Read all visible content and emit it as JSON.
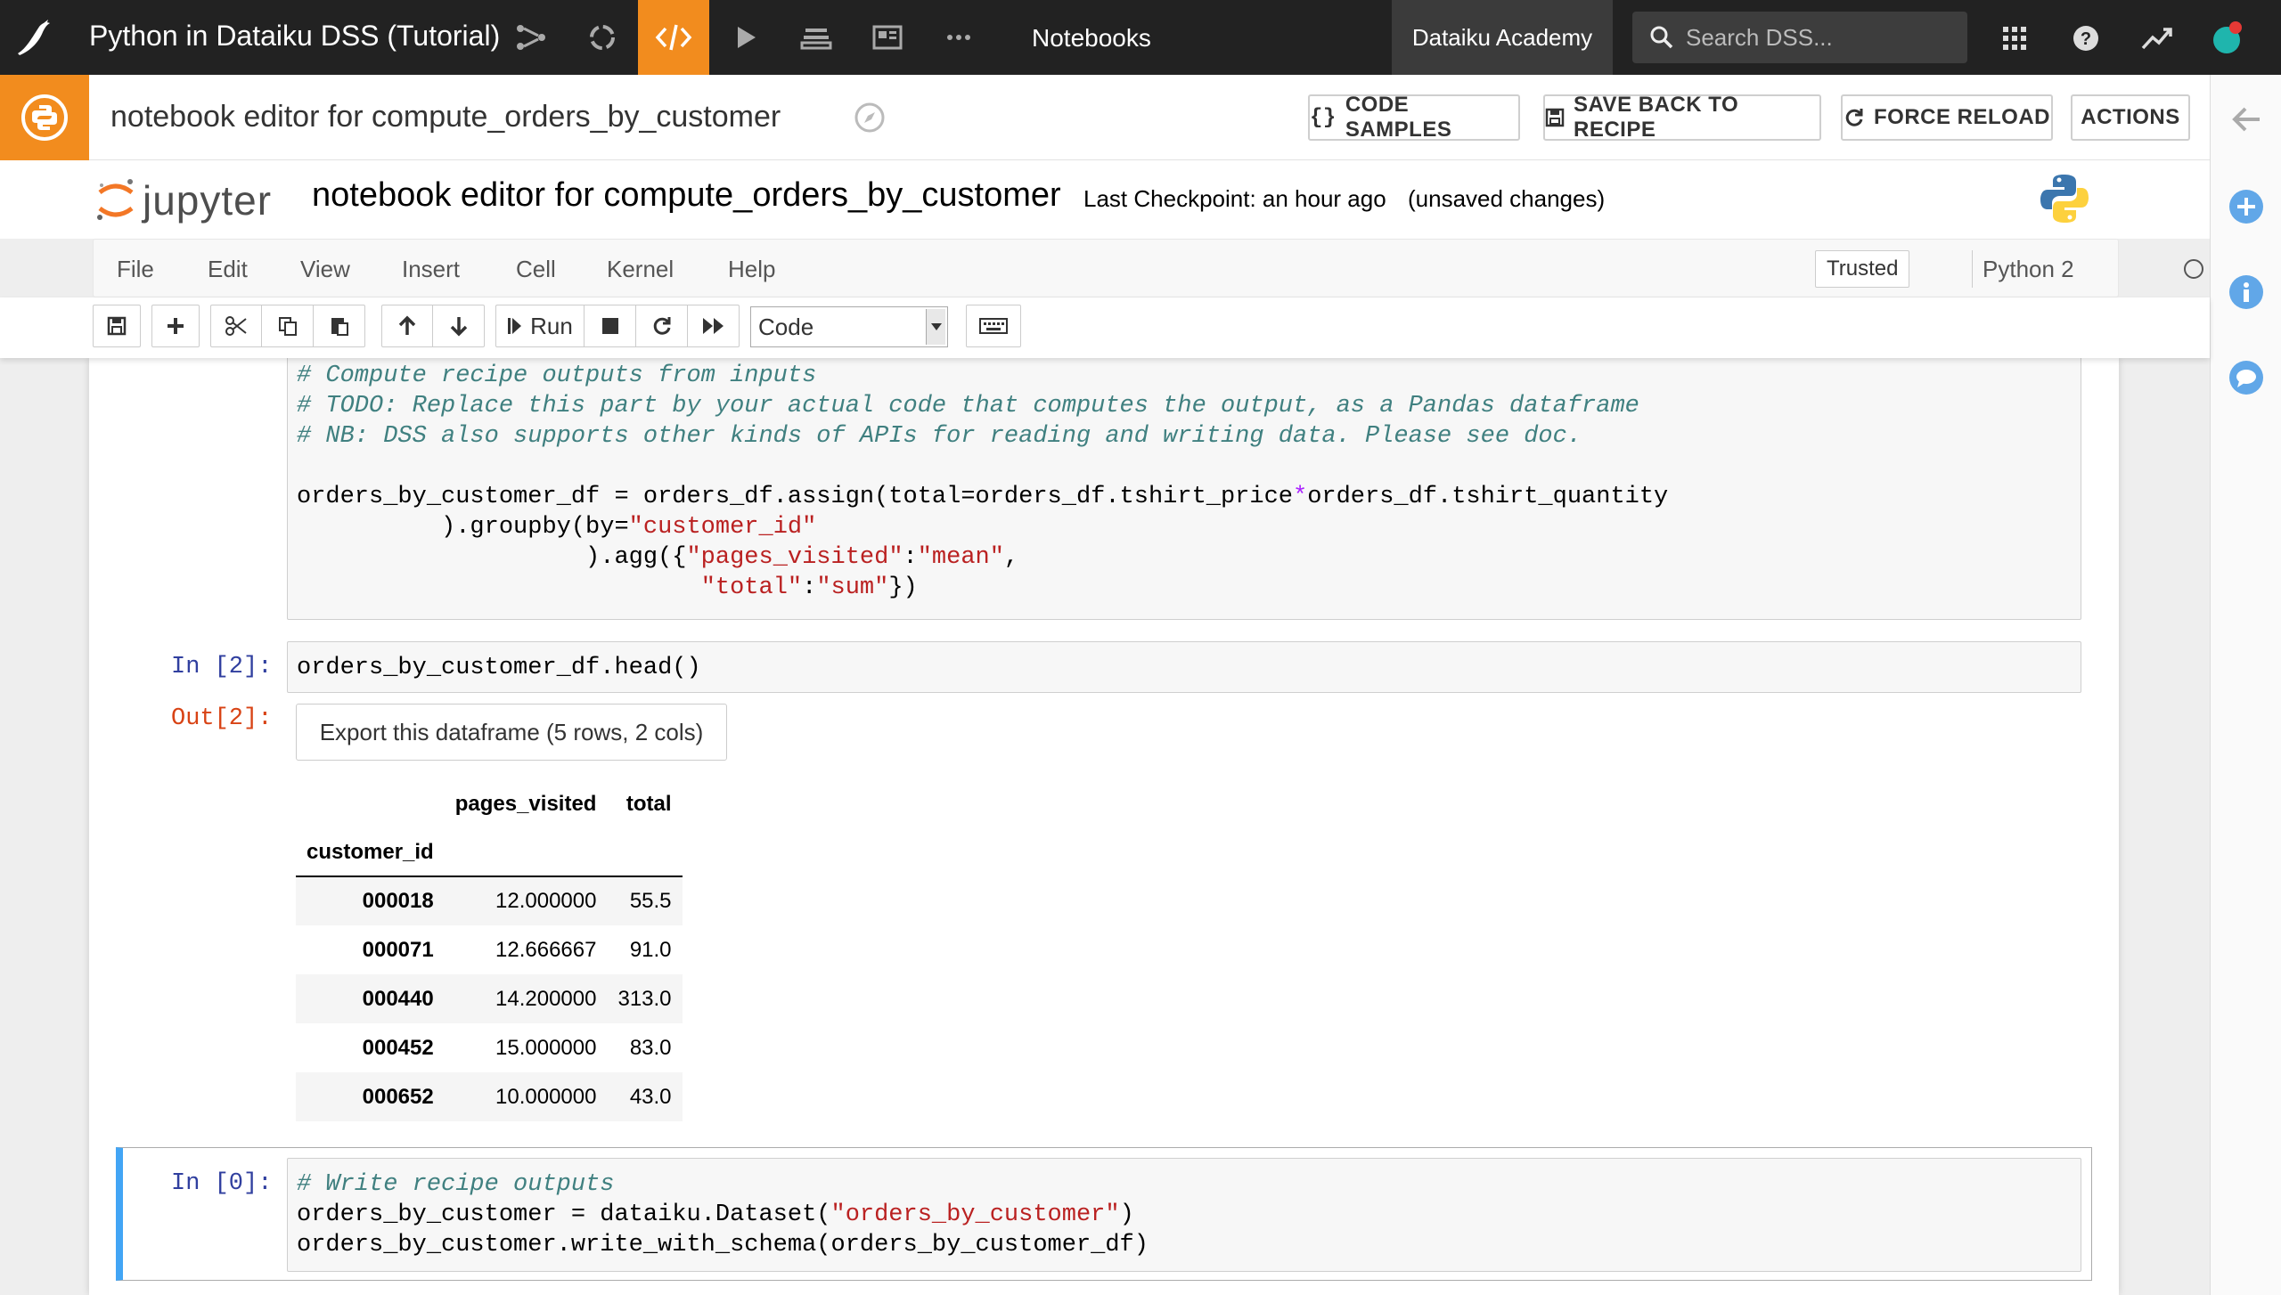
{
  "topbar": {
    "project_title": "Python in Dataiku DSS (Tutorial)",
    "section": "Notebooks",
    "academy": "Dataiku Academy",
    "search_placeholder": "Search DSS...",
    "accent": "#f28c1e"
  },
  "editor": {
    "title": "notebook editor for compute_orders_by_customer",
    "buttons": {
      "code_samples": "CODE SAMPLES",
      "save_back": "SAVE BACK TO RECIPE",
      "force_reload": "FORCE RELOAD",
      "actions": "ACTIONS"
    }
  },
  "jupyter": {
    "logo_text": "jupyter",
    "notebook_name": "notebook editor for compute_orders_by_customer",
    "checkpoint": "Last Checkpoint: an hour ago",
    "status": "(unsaved changes)",
    "menu": [
      "File",
      "Edit",
      "View",
      "Insert",
      "Cell",
      "Kernel",
      "Help"
    ],
    "trusted": "Trusted",
    "kernel": "Python 2",
    "run_label": "Run",
    "cell_type": "Code"
  },
  "cells": {
    "cell1_lines": [
      "# Compute recipe outputs from inputs",
      "# TODO: Replace this part by your actual code that computes the output, as a Pandas dataframe",
      "# NB: DSS also supports other kinds of APIs for reading and writing data. Please see doc.",
      "orders_by_customer_df = orders_df.assign(total=orders_df.tshirt_price*orders_df.tshirt_quantity",
      "          ).groupby(by=\"customer_id\"",
      "                    ).agg({\"pages_visited\":\"mean\",",
      "                            \"total\":\"sum\"})"
    ],
    "cell2_prompt": "In [2]:",
    "cell2_code": "orders_by_customer_df.head()",
    "out2_prompt": "Out[2]:",
    "export_label": "Export this dataframe (5 rows, 2 cols)",
    "dataframe": {
      "columns": [
        "pages_visited",
        "total"
      ],
      "index_name": "customer_id",
      "rows": [
        {
          "id": "000018",
          "pages_visited": "12.000000",
          "total": "55.5"
        },
        {
          "id": "000071",
          "pages_visited": "12.666667",
          "total": "91.0"
        },
        {
          "id": "000440",
          "pages_visited": "14.200000",
          "total": "313.0"
        },
        {
          "id": "000452",
          "pages_visited": "15.000000",
          "total": "83.0"
        },
        {
          "id": "000652",
          "pages_visited": "10.000000",
          "total": "43.0"
        }
      ]
    },
    "cell3_prompt": "In [0]:",
    "cell3_lines": [
      "# Write recipe outputs",
      "orders_by_customer = dataiku.Dataset(\"orders_by_customer\")",
      "orders_by_customer.write_with_schema(orders_by_customer_df)"
    ]
  }
}
